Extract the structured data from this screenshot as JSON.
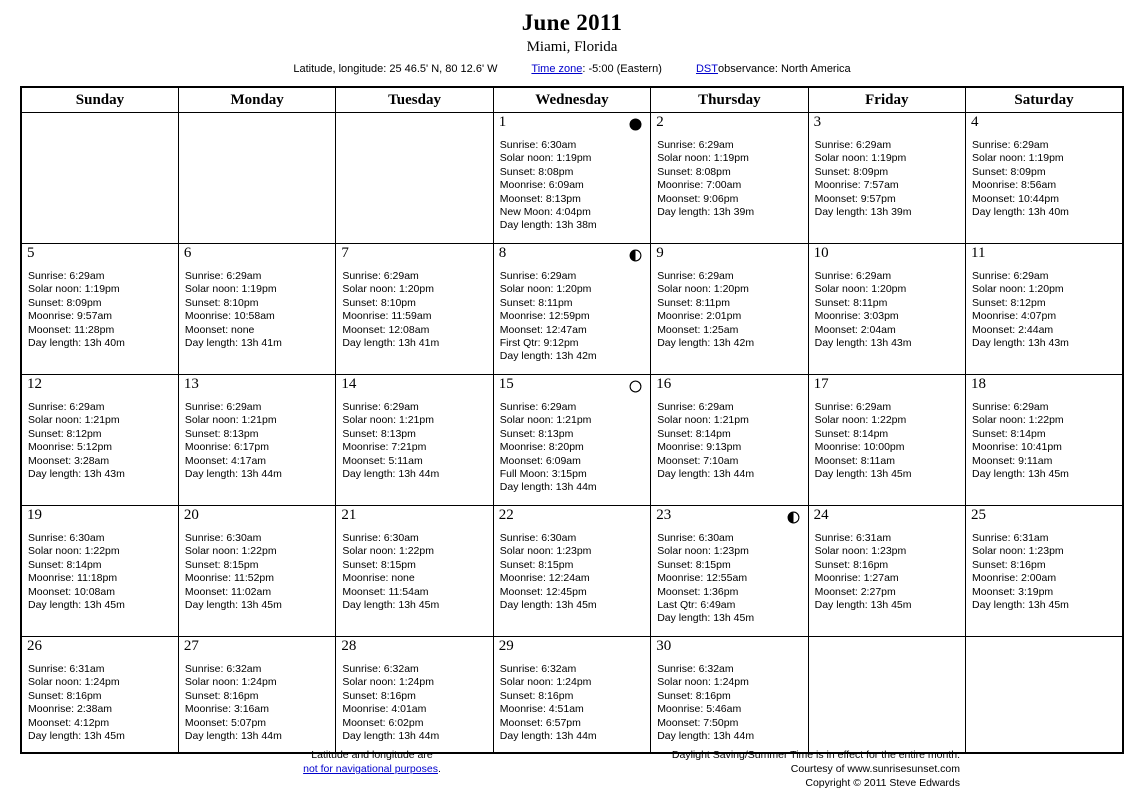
{
  "header": {
    "title": "June 2011",
    "location": "Miami, Florida",
    "latlon": "Latitude, longitude: 25 46.5' N, 80 12.6' W",
    "timezone_link": "Time zone",
    "timezone_value": ": -5:00 (Eastern)",
    "dst_link": "DST",
    "dst_value": " observance: North America"
  },
  "weekdays": [
    "Sunday",
    "Monday",
    "Tuesday",
    "Wednesday",
    "Thursday",
    "Friday",
    "Saturday"
  ],
  "labels": {
    "sunrise": "Sunrise:",
    "solar_noon": "Solar noon:",
    "sunset": "Sunset:",
    "moonrise": "Moonrise:",
    "moonset": "Moonset:",
    "day_length": "Day length:"
  },
  "phase_icons": {
    "new": "new-moon-icon",
    "first_quarter": "first-quarter-moon-icon",
    "full": "full-moon-icon",
    "last_quarter": "last-quarter-moon-icon"
  },
  "weeks": [
    [
      {
        "empty": true
      },
      {
        "empty": true
      },
      {
        "empty": true
      },
      {
        "day": "1",
        "phase": "new",
        "lines": [
          "Sunrise: 6:30am",
          "Solar noon: 1:19pm",
          "Sunset: 8:08pm",
          "Moonrise: 6:09am",
          "Moonset: 8:13pm",
          "New Moon: 4:04pm",
          "Day length: 13h 38m"
        ]
      },
      {
        "day": "2",
        "lines": [
          "Sunrise: 6:29am",
          "Solar noon: 1:19pm",
          "Sunset: 8:08pm",
          "Moonrise: 7:00am",
          "Moonset: 9:06pm",
          "Day length: 13h 39m"
        ]
      },
      {
        "day": "3",
        "lines": [
          "Sunrise: 6:29am",
          "Solar noon: 1:19pm",
          "Sunset: 8:09pm",
          "Moonrise: 7:57am",
          "Moonset: 9:57pm",
          "Day length: 13h 39m"
        ]
      },
      {
        "day": "4",
        "lines": [
          "Sunrise: 6:29am",
          "Solar noon: 1:19pm",
          "Sunset: 8:09pm",
          "Moonrise: 8:56am",
          "Moonset: 10:44pm",
          "Day length: 13h 40m"
        ]
      }
    ],
    [
      {
        "day": "5",
        "lines": [
          "Sunrise: 6:29am",
          "Solar noon: 1:19pm",
          "Sunset: 8:09pm",
          "Moonrise: 9:57am",
          "Moonset: 11:28pm",
          "Day length: 13h 40m"
        ]
      },
      {
        "day": "6",
        "lines": [
          "Sunrise: 6:29am",
          "Solar noon: 1:19pm",
          "Sunset: 8:10pm",
          "Moonrise: 10:58am",
          "Moonset: none",
          "Day length: 13h 41m"
        ]
      },
      {
        "day": "7",
        "lines": [
          "Sunrise: 6:29am",
          "Solar noon: 1:20pm",
          "Sunset: 8:10pm",
          "Moonrise: 11:59am",
          "Moonset: 12:08am",
          "Day length: 13h 41m"
        ]
      },
      {
        "day": "8",
        "phase": "first_quarter",
        "lines": [
          "Sunrise: 6:29am",
          "Solar noon: 1:20pm",
          "Sunset: 8:11pm",
          "Moonrise: 12:59pm",
          "Moonset: 12:47am",
          "First Qtr: 9:12pm",
          "Day length: 13h 42m"
        ]
      },
      {
        "day": "9",
        "lines": [
          "Sunrise: 6:29am",
          "Solar noon: 1:20pm",
          "Sunset: 8:11pm",
          "Moonrise: 2:01pm",
          "Moonset: 1:25am",
          "Day length: 13h 42m"
        ]
      },
      {
        "day": "10",
        "lines": [
          "Sunrise: 6:29am",
          "Solar noon: 1:20pm",
          "Sunset: 8:11pm",
          "Moonrise: 3:03pm",
          "Moonset: 2:04am",
          "Day length: 13h 43m"
        ]
      },
      {
        "day": "11",
        "lines": [
          "Sunrise: 6:29am",
          "Solar noon: 1:20pm",
          "Sunset: 8:12pm",
          "Moonrise: 4:07pm",
          "Moonset: 2:44am",
          "Day length: 13h 43m"
        ]
      }
    ],
    [
      {
        "day": "12",
        "lines": [
          "Sunrise: 6:29am",
          "Solar noon: 1:21pm",
          "Sunset: 8:12pm",
          "Moonrise: 5:12pm",
          "Moonset: 3:28am",
          "Day length: 13h 43m"
        ]
      },
      {
        "day": "13",
        "lines": [
          "Sunrise: 6:29am",
          "Solar noon: 1:21pm",
          "Sunset: 8:13pm",
          "Moonrise: 6:17pm",
          "Moonset: 4:17am",
          "Day length: 13h 44m"
        ]
      },
      {
        "day": "14",
        "lines": [
          "Sunrise: 6:29am",
          "Solar noon: 1:21pm",
          "Sunset: 8:13pm",
          "Moonrise: 7:21pm",
          "Moonset: 5:11am",
          "Day length: 13h 44m"
        ]
      },
      {
        "day": "15",
        "phase": "full",
        "lines": [
          "Sunrise: 6:29am",
          "Solar noon: 1:21pm",
          "Sunset: 8:13pm",
          "Moonrise: 8:20pm",
          "Moonset: 6:09am",
          "Full Moon: 3:15pm",
          "Day length: 13h 44m"
        ]
      },
      {
        "day": "16",
        "lines": [
          "Sunrise: 6:29am",
          "Solar noon: 1:21pm",
          "Sunset: 8:14pm",
          "Moonrise: 9:13pm",
          "Moonset: 7:10am",
          "Day length: 13h 44m"
        ]
      },
      {
        "day": "17",
        "lines": [
          "Sunrise: 6:29am",
          "Solar noon: 1:22pm",
          "Sunset: 8:14pm",
          "Moonrise: 10:00pm",
          "Moonset: 8:11am",
          "Day length: 13h 45m"
        ]
      },
      {
        "day": "18",
        "lines": [
          "Sunrise: 6:29am",
          "Solar noon: 1:22pm",
          "Sunset: 8:14pm",
          "Moonrise: 10:41pm",
          "Moonset: 9:11am",
          "Day length: 13h 45m"
        ]
      }
    ],
    [
      {
        "day": "19",
        "lines": [
          "Sunrise: 6:30am",
          "Solar noon: 1:22pm",
          "Sunset: 8:14pm",
          "Moonrise: 11:18pm",
          "Moonset: 10:08am",
          "Day length: 13h 45m"
        ]
      },
      {
        "day": "20",
        "lines": [
          "Sunrise: 6:30am",
          "Solar noon: 1:22pm",
          "Sunset: 8:15pm",
          "Moonrise: 11:52pm",
          "Moonset: 11:02am",
          "Day length: 13h 45m"
        ]
      },
      {
        "day": "21",
        "lines": [
          "Sunrise: 6:30am",
          "Solar noon: 1:22pm",
          "Sunset: 8:15pm",
          "Moonrise: none",
          "Moonset: 11:54am",
          "Day length: 13h 45m"
        ]
      },
      {
        "day": "22",
        "lines": [
          "Sunrise: 6:30am",
          "Solar noon: 1:23pm",
          "Sunset: 8:15pm",
          "Moonrise: 12:24am",
          "Moonset: 12:45pm",
          "Day length: 13h 45m"
        ]
      },
      {
        "day": "23",
        "phase": "last_quarter",
        "lines": [
          "Sunrise: 6:30am",
          "Solar noon: 1:23pm",
          "Sunset: 8:15pm",
          "Moonrise: 12:55am",
          "Moonset: 1:36pm",
          "Last Qtr: 6:49am",
          "Day length: 13h 45m"
        ]
      },
      {
        "day": "24",
        "lines": [
          "Sunrise: 6:31am",
          "Solar noon: 1:23pm",
          "Sunset: 8:16pm",
          "Moonrise: 1:27am",
          "Moonset: 2:27pm",
          "Day length: 13h 45m"
        ]
      },
      {
        "day": "25",
        "lines": [
          "Sunrise: 6:31am",
          "Solar noon: 1:23pm",
          "Sunset: 8:16pm",
          "Moonrise: 2:00am",
          "Moonset: 3:19pm",
          "Day length: 13h 45m"
        ]
      }
    ],
    [
      {
        "day": "26",
        "lines": [
          "Sunrise: 6:31am",
          "Solar noon: 1:24pm",
          "Sunset: 8:16pm",
          "Moonrise: 2:38am",
          "Moonset: 4:12pm",
          "Day length: 13h 45m"
        ]
      },
      {
        "day": "27",
        "lines": [
          "Sunrise: 6:32am",
          "Solar noon: 1:24pm",
          "Sunset: 8:16pm",
          "Moonrise: 3:16am",
          "Moonset: 5:07pm",
          "Day length: 13h 44m"
        ]
      },
      {
        "day": "28",
        "lines": [
          "Sunrise: 6:32am",
          "Solar noon: 1:24pm",
          "Sunset: 8:16pm",
          "Moonrise: 4:01am",
          "Moonset: 6:02pm",
          "Day length: 13h 44m"
        ]
      },
      {
        "day": "29",
        "lines": [
          "Sunrise: 6:32am",
          "Solar noon: 1:24pm",
          "Sunset: 8:16pm",
          "Moonrise: 4:51am",
          "Moonset: 6:57pm",
          "Day length: 13h 44m"
        ]
      },
      {
        "day": "30",
        "lines": [
          "Sunrise: 6:32am",
          "Solar noon: 1:24pm",
          "Sunset: 8:16pm",
          "Moonrise: 5:46am",
          "Moonset: 7:50pm",
          "Day length: 13h 44m"
        ]
      },
      {
        "empty": true
      },
      {
        "empty": true
      }
    ]
  ],
  "footer": {
    "disclaimer_line1": "Latitude and longitude are",
    "disclaimer_link": "not for navigational purposes",
    "disclaimer_period": ".",
    "dst_note": "Daylight Saving/Summer Time is in effect for the entire month.",
    "courtesy": "Courtesy of www.sunrisesunset.com",
    "copyright": "Copyright © 2011 Steve Edwards"
  },
  "colors": {
    "link": "#0000cc",
    "text": "#000000",
    "border": "#000000",
    "background": "#ffffff"
  }
}
